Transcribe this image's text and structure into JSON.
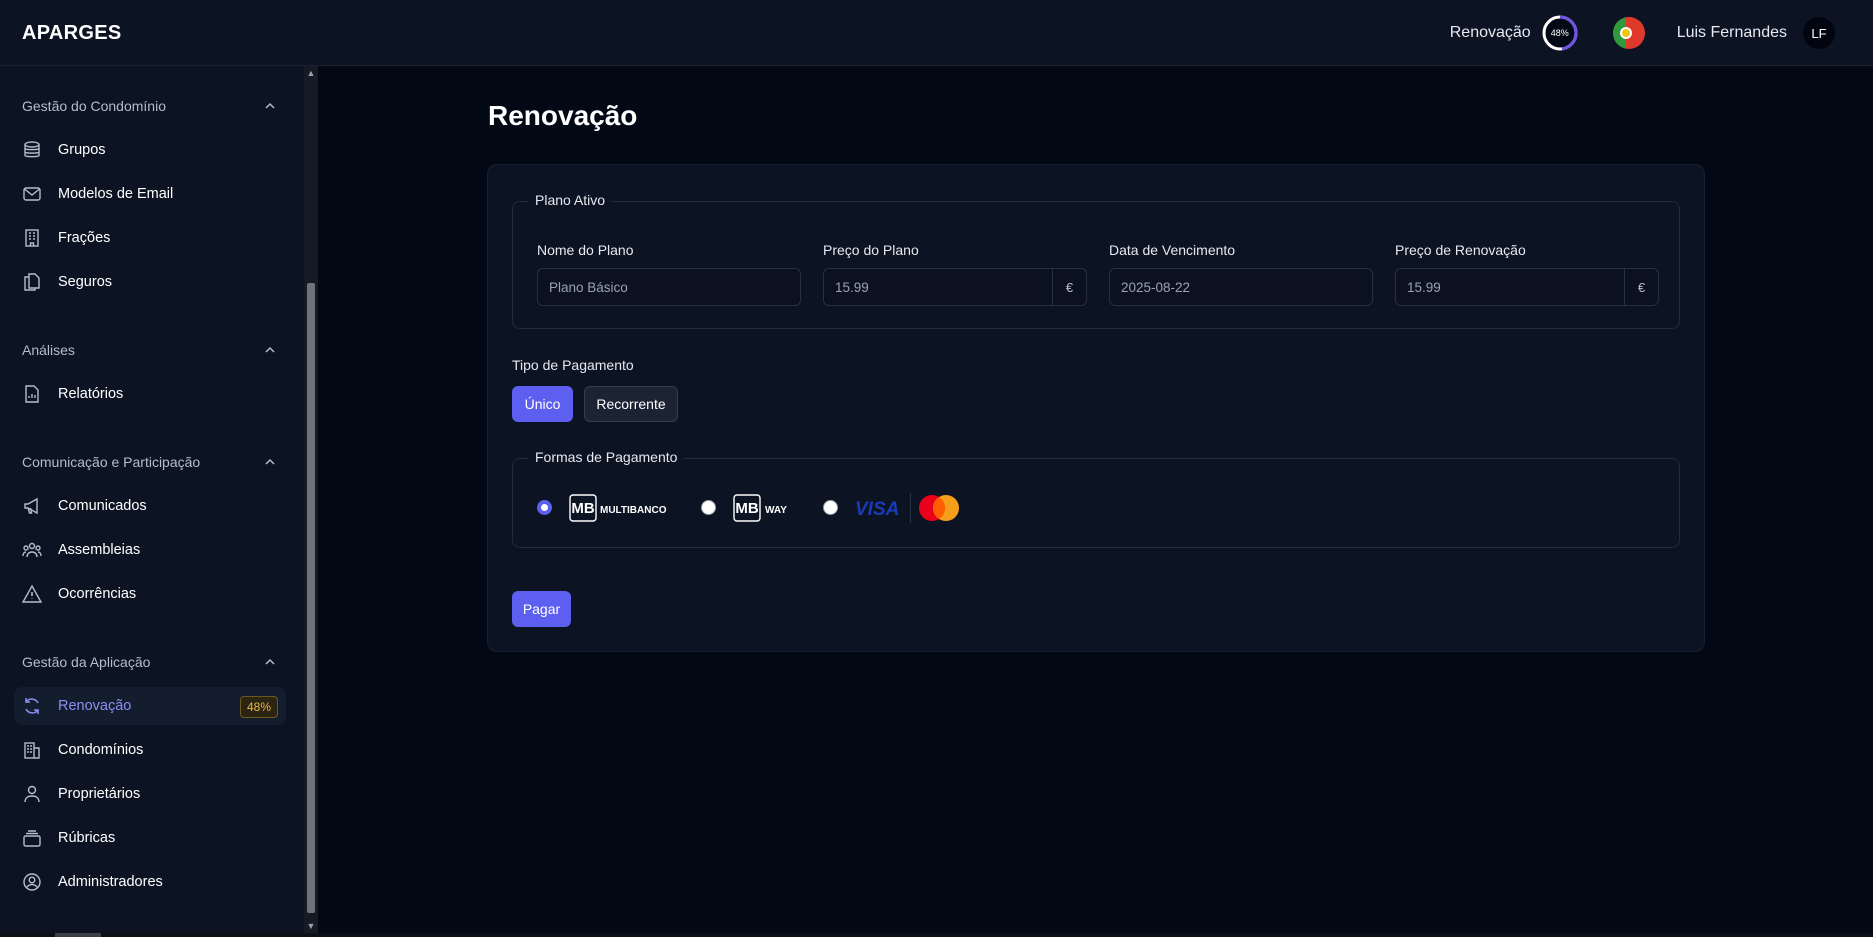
{
  "header": {
    "brand": "APARGES",
    "renewal_label": "Renovação",
    "renewal_progress": "48%",
    "renewal_progress_value": 0.48,
    "user_name": "Luis Fernandes",
    "user_initials": "LF",
    "accent_color": "#5d5ff0"
  },
  "sidebar": {
    "sections": [
      {
        "title": "Gestão do Condomínio",
        "items": [
          {
            "label": "Grupos",
            "icon": "database-icon"
          },
          {
            "label": "Modelos de Email",
            "icon": "mail-icon"
          },
          {
            "label": "Frações",
            "icon": "building-icon"
          },
          {
            "label": "Seguros",
            "icon": "documents-icon"
          }
        ]
      },
      {
        "title": "Análises",
        "items": [
          {
            "label": "Relatórios",
            "icon": "report-icon"
          }
        ]
      },
      {
        "title": "Comunicação e Participação",
        "items": [
          {
            "label": "Comunicados",
            "icon": "megaphone-icon"
          },
          {
            "label": "Assembleias",
            "icon": "people-icon"
          },
          {
            "label": "Ocorrências",
            "icon": "warning-icon"
          }
        ]
      },
      {
        "title": "Gestão da Aplicação",
        "items": [
          {
            "label": "Renovação",
            "icon": "refresh-icon",
            "badge": "48%",
            "active": true
          },
          {
            "label": "Condomínios",
            "icon": "office-building-icon"
          },
          {
            "label": "Proprietários",
            "icon": "user-icon"
          },
          {
            "label": "Rúbricas",
            "icon": "stack-icon"
          },
          {
            "label": "Administradores",
            "icon": "user-circle-icon"
          }
        ]
      }
    ]
  },
  "main": {
    "title": "Renovação",
    "active_plan": {
      "legend": "Plano Ativo",
      "plan_name_label": "Nome do Plano",
      "plan_name_value": "Plano Básico",
      "plan_price_label": "Preço do Plano",
      "plan_price_value": "15.99",
      "currency": "€",
      "due_date_label": "Data de Vencimento",
      "due_date_value": "2025-08-22",
      "renewal_price_label": "Preço de Renovação",
      "renewal_price_value": "15.99"
    },
    "payment_type": {
      "label": "Tipo de Pagamento",
      "options": [
        "Único",
        "Recorrente"
      ],
      "selected": "Único"
    },
    "payment_methods": {
      "legend": "Formas de Pagamento",
      "options": [
        {
          "logo_text": "MULTIBANCO",
          "logo_mark": "MB",
          "selected": true
        },
        {
          "logo_text": "WAY",
          "logo_mark": "MB",
          "selected": false
        },
        {
          "logo_text": "VISA",
          "selected": false
        }
      ]
    },
    "pay_button": "Pagar"
  }
}
